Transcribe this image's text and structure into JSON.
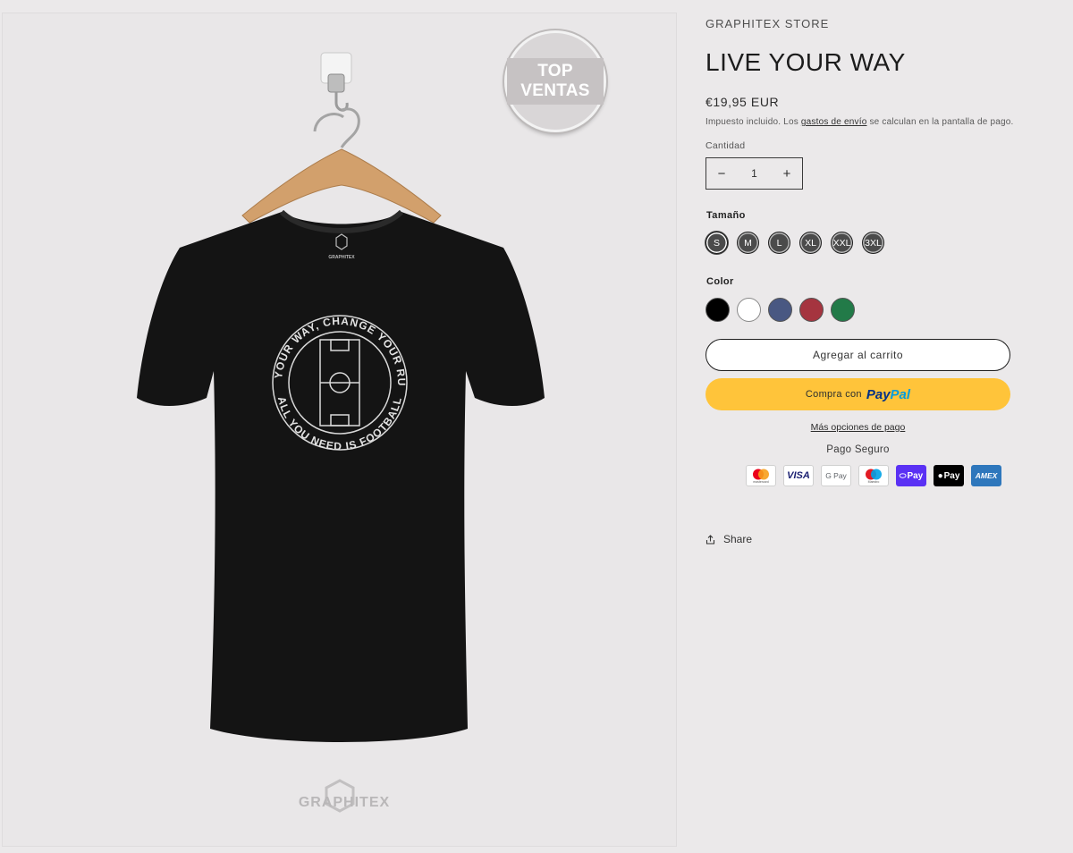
{
  "badge": {
    "line1": "TOP",
    "line2": "VENTAS"
  },
  "product_image": {
    "shirt_print_top": "LIVE YOUR WAY, CHANGE YOUR RULES",
    "shirt_print_bottom": "ALL YOU NEED IS FOOTBALL",
    "neck_label": "GRAPHITEX",
    "watermark": "GRAPHITEX",
    "shirt_color": "#141414"
  },
  "product": {
    "vendor": "GRAPHITEX STORE",
    "title": "LIVE YOUR WAY",
    "price": "€19,95 EUR",
    "tax_prefix": "Impuesto incluido. Los ",
    "tax_link": "gastos de envío",
    "tax_suffix": " se calculan en la pantalla de pago."
  },
  "quantity": {
    "label": "Cantidad",
    "value": "1",
    "minus": "−",
    "plus": "+"
  },
  "size": {
    "label": "Tamaño",
    "options": [
      "S",
      "M",
      "L",
      "XL",
      "XXL",
      "3XL"
    ],
    "selected": "S"
  },
  "color": {
    "label": "Color",
    "swatches": [
      {
        "name": "black",
        "hex": "#000000"
      },
      {
        "name": "white",
        "hex": "#ffffff"
      },
      {
        "name": "navy",
        "hex": "#495882"
      },
      {
        "name": "red",
        "hex": "#a5343f"
      },
      {
        "name": "green",
        "hex": "#227a48"
      }
    ],
    "selected": "black"
  },
  "actions": {
    "add_to_cart": "Agregar al carrito",
    "paypal_prefix": "Compra con",
    "paypal_brand_1": "Pay",
    "paypal_brand_2": "Pal",
    "more_options": "Más opciones de pago"
  },
  "secure": {
    "label": "Pago Seguro",
    "methods": [
      {
        "name": "mastercard-icon",
        "text": "mastercard"
      },
      {
        "name": "visa-icon",
        "text": "VISA"
      },
      {
        "name": "google-pay-icon",
        "text": "G Pay"
      },
      {
        "name": "maestro-icon",
        "text": "Maestro"
      },
      {
        "name": "shop-pay-icon",
        "text": "Pay"
      },
      {
        "name": "apple-pay-icon",
        "text": "Pay"
      },
      {
        "name": "amex-icon",
        "text": "AMEX"
      }
    ]
  },
  "share": {
    "label": "Share"
  }
}
